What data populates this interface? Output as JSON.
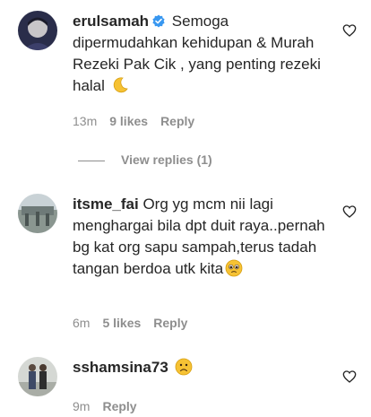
{
  "comments": [
    {
      "username": "erulsamah",
      "verified": true,
      "text": "Semoga dipermudahkan kehidupan & Murah Rezeki Pak Cik , yang penting rezeki halal",
      "emoji": "crescent-moon",
      "time": "13m",
      "likes": "9 likes",
      "reply": "Reply",
      "view_replies": "View replies (1)"
    },
    {
      "username": "itsme_fai",
      "verified": false,
      "text": "Org yg mcm nii lagi menghargai bila dpt duit raya..pernah bg kat org sapu sampah,terus tadah tangan berdoa utk kita",
      "emoji": "pleading-face",
      "time": "6m",
      "likes": "5 likes",
      "reply": "Reply"
    },
    {
      "username": "sshamsina73",
      "verified": false,
      "text": "",
      "emoji": "frowning-face",
      "time": "9m",
      "likes": "",
      "reply": "Reply"
    }
  ],
  "colors": {
    "text": "#262626",
    "muted": "#8e8e8e",
    "verified": "#3897f0"
  }
}
